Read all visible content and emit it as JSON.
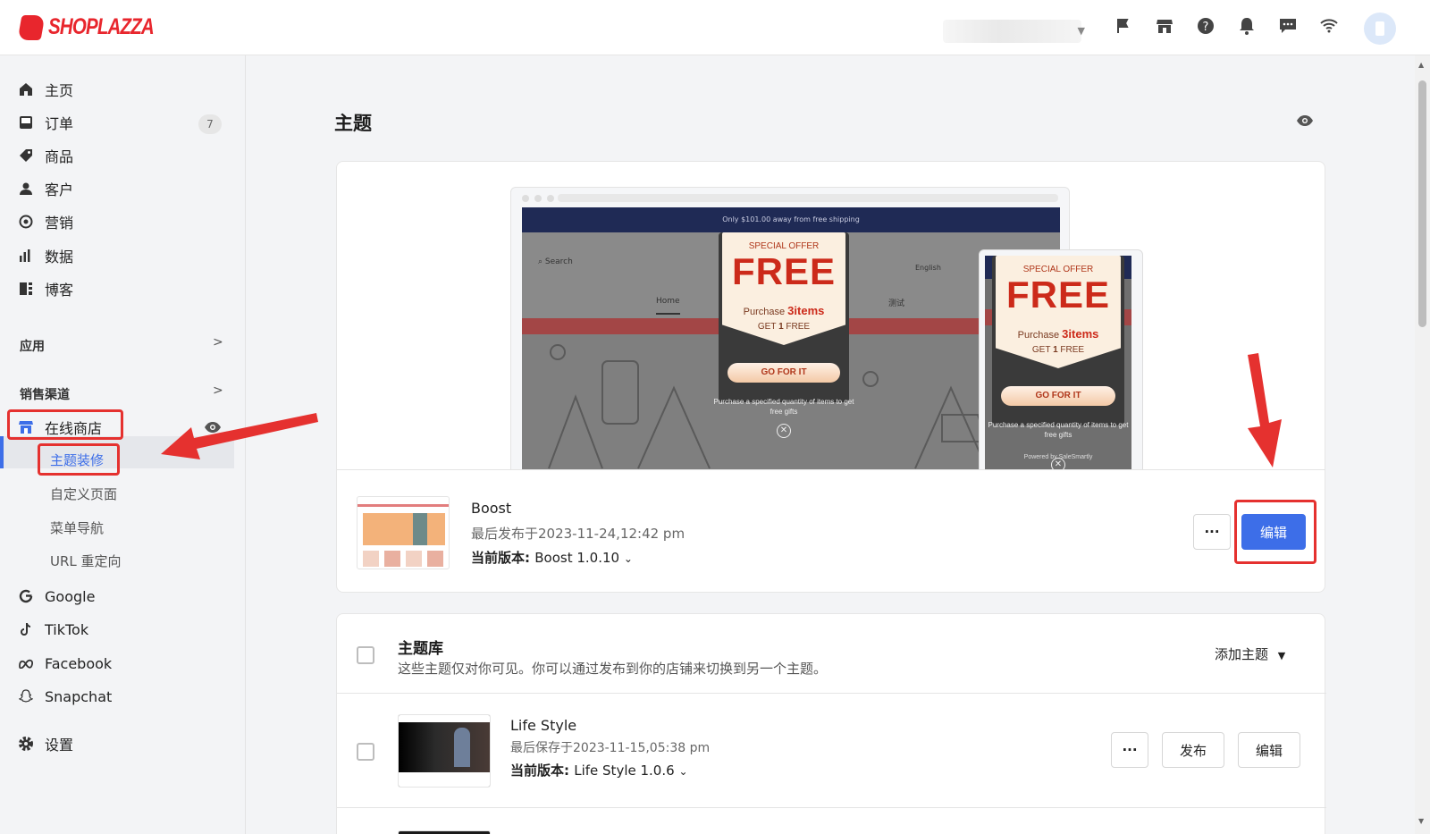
{
  "brand": {
    "name": "SHOPLAZZA",
    "color": "#e8262d"
  },
  "accent": "#3d6ee8",
  "topbar": {
    "icons": [
      "flag-icon",
      "store-icon",
      "help-icon",
      "bell-icon",
      "chat-icon",
      "wifi-icon"
    ]
  },
  "sidebar": {
    "items": [
      {
        "label": "主页",
        "icon": "home-icon"
      },
      {
        "label": "订单",
        "icon": "inbox-icon",
        "badge": "7"
      },
      {
        "label": "商品",
        "icon": "tag-icon"
      },
      {
        "label": "客户",
        "icon": "person-icon"
      },
      {
        "label": "营销",
        "icon": "target-icon"
      },
      {
        "label": "数据",
        "icon": "bar-chart-icon"
      },
      {
        "label": "博客",
        "icon": "blog-icon"
      }
    ],
    "apps_label": "应用",
    "channels_label": "销售渠道",
    "online_store": "在线商店",
    "sub_items": [
      "主题装修",
      "自定义页面",
      "菜单导航",
      "URL 重定向"
    ],
    "channels": [
      "Google",
      "TikTok",
      "Facebook",
      "Snapchat"
    ],
    "settings": "设置"
  },
  "main": {
    "title": "主题",
    "preview": {
      "announcement": "Only $101.00 away from free shipping",
      "search": "Search",
      "language": "English",
      "menu_home": "Home",
      "menu_test": "测试",
      "popup": {
        "special_offer": "SPECIAL OFFER",
        "free": "FREE",
        "purchase": "Purchase",
        "items": "3items",
        "get": "GET",
        "get_num": "1",
        "get_free": "FREE",
        "go": "GO FOR IT",
        "desc": "Purchase a specified quantity of items to get free gifts",
        "powered": "Powered by SaleSmartly"
      }
    },
    "current_theme": {
      "name": "Boost",
      "published": "最后发布于2023-11-24,12:42 pm",
      "version_label": "当前版本: ",
      "version": "Boost 1.0.10",
      "more_label": "···",
      "edit_label": "编辑"
    },
    "library": {
      "title": "主题库",
      "description": "这些主题仅对你可见。你可以通过发布到你的店铺来切换到另一个主题。",
      "add_label": "添加主题",
      "themes": [
        {
          "name": "Life Style",
          "saved": "最后保存于2023-11-15,05:38 pm",
          "version_label": "当前版本: ",
          "version": "Life Style 1.0.6",
          "more_label": "···",
          "publish_label": "发布",
          "edit_label": "编辑"
        }
      ]
    }
  }
}
